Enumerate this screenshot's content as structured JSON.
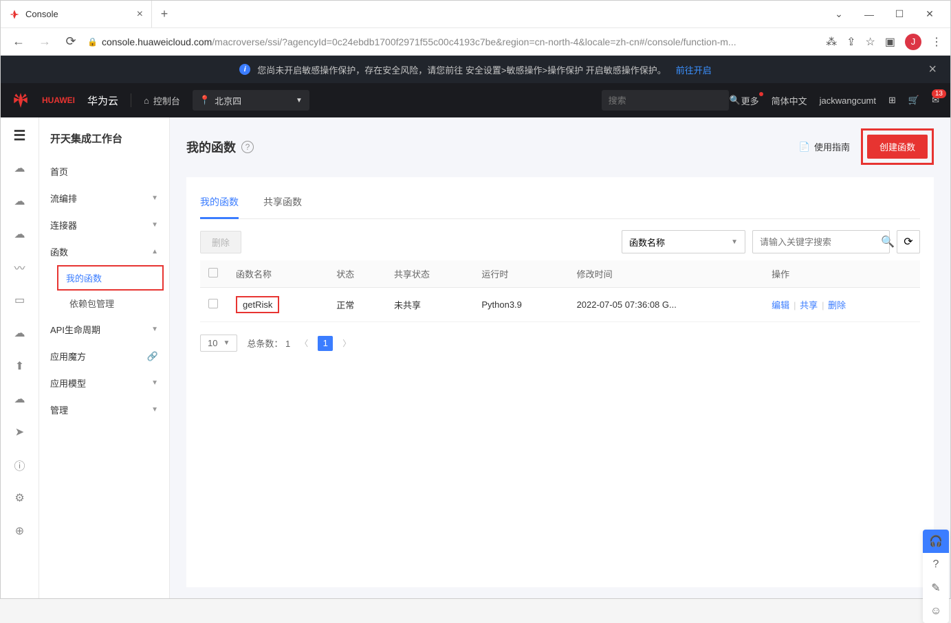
{
  "browser": {
    "tab_title": "Console",
    "url_display_prefix": "console.huaweicloud.com",
    "url_display_suffix": "/macroverse/ssi/?agencyId=0c24ebdb1700f2971f55c00c4193c7be&region=cn-north-4&locale=zh-cn#/console/function-m...",
    "avatar_letter": "J"
  },
  "notice": {
    "text": "您尚未开启敏感操作保护，存在安全风险，请您前往 安全设置>敏感操作>操作保护 开启敏感操作保护。",
    "link": "前往开启"
  },
  "topnav": {
    "logo_text": "HUAWEI",
    "brand": "华为云",
    "console": "控制台",
    "region": "北京四",
    "search_placeholder": "搜索",
    "more": "更多",
    "lang": "简体中文",
    "username": "jackwangcumt",
    "mail_count": "13"
  },
  "sidebar": {
    "workspace_title": "开天集成工作台",
    "items": {
      "home": "首页",
      "flow": "流编排",
      "connector": "连接器",
      "function": "函数",
      "my_functions": "我的函数",
      "dep_management": "依赖包管理",
      "api_lifecycle": "API生命周期",
      "app_cube": "应用魔方",
      "app_model": "应用模型",
      "management": "管理"
    }
  },
  "main": {
    "title": "我的函数",
    "guide": "使用指南",
    "create_btn": "创建函数",
    "tabs": {
      "mine": "我的函数",
      "shared": "共享函数"
    },
    "delete_btn": "删除",
    "filter_field": "函数名称",
    "search_placeholder": "请输入关键字搜索",
    "columns": {
      "name": "函数名称",
      "status": "状态",
      "share_status": "共享状态",
      "runtime": "运行时",
      "modify_time": "修改时间",
      "ops": "操作"
    },
    "rows": [
      {
        "name": "getRisk",
        "status": "正常",
        "share_status": "未共享",
        "runtime": "Python3.9",
        "modify_time": "2022-07-05 07:36:08 G..."
      }
    ],
    "row_actions": {
      "edit": "编辑",
      "share": "共享",
      "delete": "删除"
    },
    "pager": {
      "size": "10",
      "total_label": "总条数： 1",
      "current": "1"
    }
  }
}
